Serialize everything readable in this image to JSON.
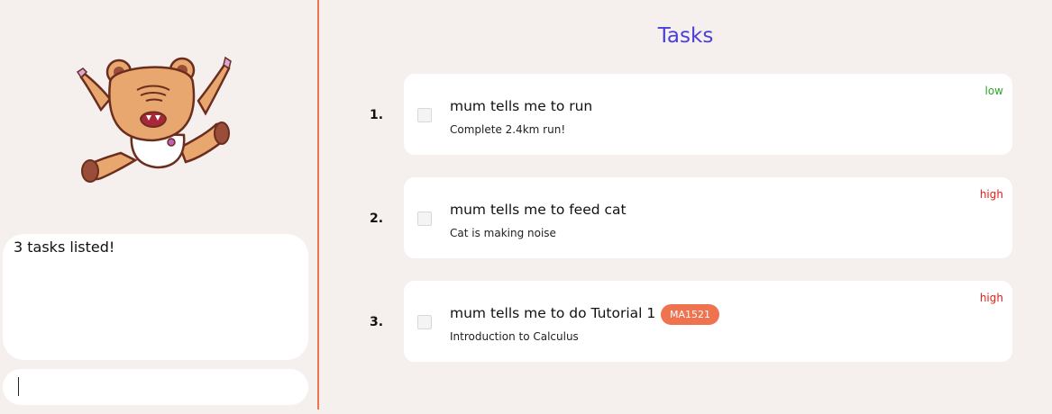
{
  "left": {
    "mascot_icon": "angry-bear-icon",
    "result_text": "3 tasks listed!",
    "command_input": {
      "value": "",
      "placeholder": ""
    }
  },
  "main": {
    "title": "Tasks",
    "tasks": [
      {
        "index": "1.",
        "name": "mum tells me to run",
        "description": "Complete 2.4km run!",
        "priority": "low",
        "tags": [],
        "done": false
      },
      {
        "index": "2.",
        "name": "mum tells me to feed cat",
        "description": "Cat is making noise",
        "priority": "high",
        "tags": [],
        "done": false
      },
      {
        "index": "3.",
        "name": "mum tells me to do Tutorial 1",
        "description": "Introduction to Calculus",
        "priority": "high",
        "tags": [
          "MA1521"
        ],
        "done": false
      }
    ]
  },
  "colors": {
    "background": "#f5f0ee",
    "accent": "#f0734f",
    "title": "#4a3fd6",
    "priority_low": "#2ca72c",
    "priority_high": "#e0201a",
    "tag_bg": "#f0734f"
  }
}
